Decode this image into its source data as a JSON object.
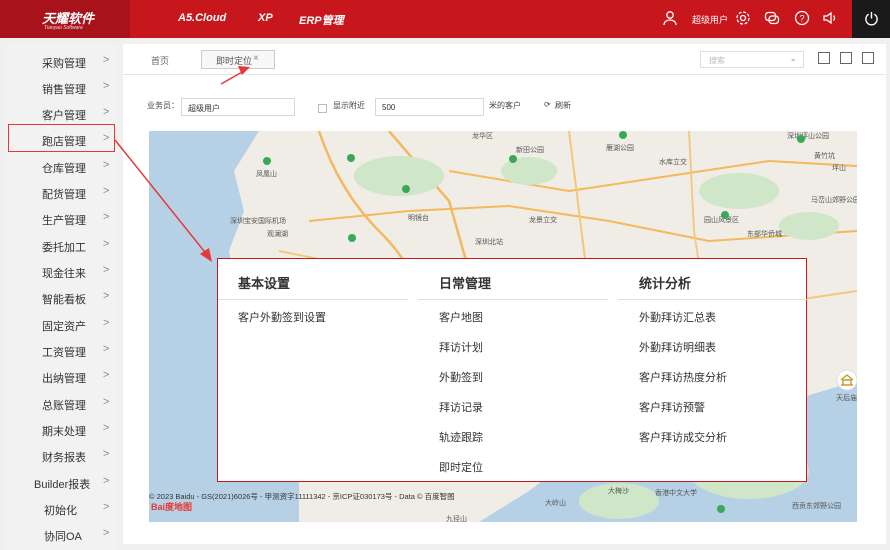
{
  "topbar": {
    "brand_cn": "天耀软件",
    "brand_en": "Tianyao Software",
    "nav": [
      "A5.Cloud",
      "XP",
      "ERP管理"
    ],
    "user_label": "超级用户"
  },
  "sidebar": {
    "items": [
      "采购管理",
      "销售管理",
      "客户管理",
      "跑店管理",
      "仓库管理",
      "配货管理",
      "生产管理",
      "委托加工",
      "现金往来",
      "智能看板",
      "固定资产",
      "工资管理",
      "出纳管理",
      "总账管理",
      "期末处理",
      "财务报表",
      "Builder报表",
      "初始化",
      "协同OA"
    ],
    "active_index": 3
  },
  "tabs": {
    "home": "首页",
    "active": "即时定位",
    "close": "×"
  },
  "search": {
    "placeholder": "搜索"
  },
  "filter": {
    "salesman_label": "业务员：",
    "salesman_value": "超级用户",
    "show_nearby_label": "显示附近",
    "distance_value": "500",
    "distance_suffix": "米的客户",
    "refresh_label": "刷新"
  },
  "map": {
    "labels": [
      "龙华区",
      "新田公园",
      "雁湖公园",
      "水库立交",
      "黄竹坑",
      "深圳坪山公园",
      "坪山",
      "凤凰山",
      "宝安",
      "宝安国际机场",
      "观澜湖",
      "深圳宝安国际机场",
      "明镜台",
      "深圳北站",
      "龙景立交",
      "马峦山郊野公园",
      "东部华侨城",
      "园山风景区",
      "大梅沙",
      "香港中文大学",
      "西贡东郊野公园",
      "大岭山",
      "天后庙",
      "九径山"
    ],
    "attribution": "© 2023 Baidu - GS(2021)6026号 - 甲测资字11111342 - 京ICP证030173号 - Data © 百度智图",
    "baidu_logo": "Bai度地图"
  },
  "popup": {
    "columns": [
      {
        "title": "基本设置",
        "items": [
          "客户外勤签到设置"
        ]
      },
      {
        "title": "日常管理",
        "items": [
          "客户地图",
          "拜访计划",
          "外勤签到",
          "拜访记录",
          "轨迹跟踪",
          "即时定位"
        ]
      },
      {
        "title": "统计分析",
        "items": [
          "外勤拜访汇总表",
          "外勤拜访明细表",
          "客户拜访热度分析",
          "客户拜访预警",
          "客户拜访成交分析"
        ]
      }
    ]
  },
  "colors": {
    "brand_red": "#c8161d",
    "map_water": "#b6d1e5",
    "map_land": "#efede6",
    "green_area": "#cfe6c8"
  }
}
